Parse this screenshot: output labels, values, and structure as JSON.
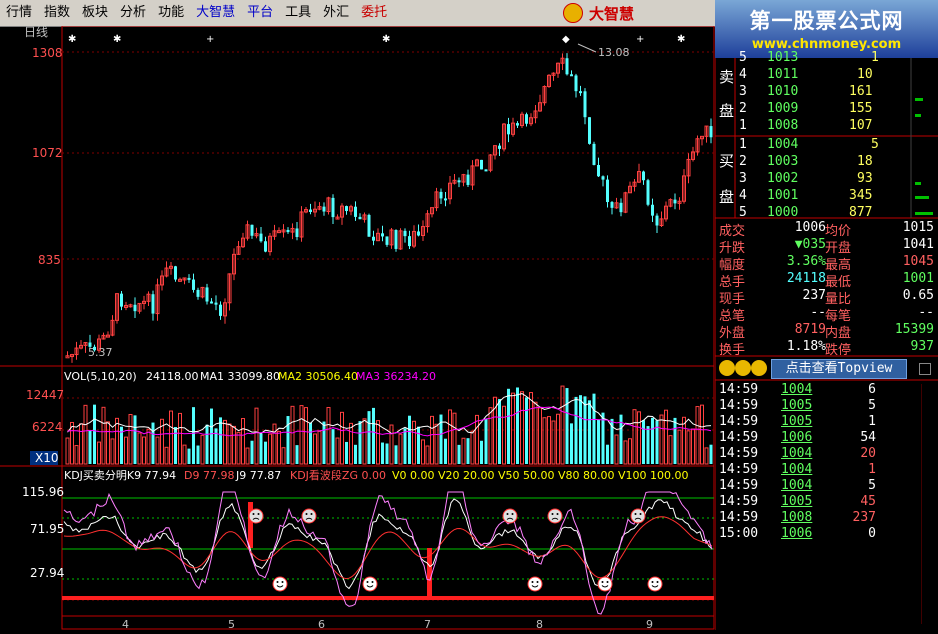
{
  "menu": [
    "行情",
    "指数",
    "板块",
    "分析",
    "功能",
    "大智慧",
    "平台",
    "工具",
    "外汇",
    "委托"
  ],
  "brand": "大智慧",
  "banner": {
    "title": "第一股票公式网",
    "url": "www.chnmoney.com"
  },
  "chart": {
    "period_label": "日线",
    "price_labels": [
      "1308",
      "1072",
      "835"
    ],
    "high_label": "13.08",
    "low_label": "5.37",
    "vol_labels": [
      "12447",
      "6224",
      "X10"
    ],
    "vol_legend": {
      "title": "VOL(5,10,20)",
      "v": "24118.00",
      "ma1": "MA1 33099.80",
      "ma2": "MA2 30506.40",
      "ma3": "MA3 36234.20"
    },
    "kdj_labels": [
      "115.96",
      "71.95",
      "27.94"
    ],
    "kdj_legend": {
      "title": "KDJ买卖分明K9 77.94",
      "d": "D9 77.98",
      "j": "J9 77.87",
      "zg": "KDJ看波段ZG 0.00",
      "rest": "V0 0.00 V20 20.00 V50 50.00 V80 80.00 V100 100.00"
    },
    "x_ticks": [
      "4",
      "5",
      "6",
      "7",
      "8",
      "9"
    ],
    "colors": {
      "up": "#ff4040",
      "down": "#54ffff",
      "ma1": "#ffffff",
      "ma2": "#ffff00",
      "ma3": "#ff00ff",
      "axis": "#c00000"
    }
  },
  "orderbook": {
    "sell_label": [
      "卖",
      "盘"
    ],
    "buy_label": [
      "买",
      "盘"
    ],
    "sell": [
      {
        "lvl": "5",
        "price": "1013",
        "vol": "1"
      },
      {
        "lvl": "4",
        "price": "1011",
        "vol": "10"
      },
      {
        "lvl": "3",
        "price": "1010",
        "vol": "161"
      },
      {
        "lvl": "2",
        "price": "1009",
        "vol": "155"
      },
      {
        "lvl": "1",
        "price": "1008",
        "vol": "107"
      }
    ],
    "buy": [
      {
        "lvl": "1",
        "price": "1004",
        "vol": "5"
      },
      {
        "lvl": "2",
        "price": "1003",
        "vol": "18"
      },
      {
        "lvl": "3",
        "price": "1002",
        "vol": "93"
      },
      {
        "lvl": "4",
        "price": "1001",
        "vol": "345"
      },
      {
        "lvl": "5",
        "price": "1000",
        "vol": "877"
      }
    ]
  },
  "stats": [
    {
      "l1": "成交",
      "v1": "1006",
      "l2": "均价",
      "v2": "1015"
    },
    {
      "l1": "升跌",
      "v1": "▼035",
      "l2": "开盘",
      "v2": "1041"
    },
    {
      "l1": "幅度",
      "v1": "3.36%",
      "l2": "最高",
      "v2": "1045"
    },
    {
      "l1": "总手",
      "v1": "24118",
      "l2": "最低",
      "v2": "1001"
    },
    {
      "l1": "现手",
      "v1": "237",
      "l2": "量比",
      "v2": "0.65"
    },
    {
      "l1": "总笔",
      "v1": "--",
      "l2": "每笔",
      "v2": "--"
    },
    {
      "l1": "外盘",
      "v1": "8719",
      "l2": "内盘",
      "v2": "15399"
    },
    {
      "l1": "换手",
      "v1": "1.18%",
      "l2": "跌停",
      "v2": "937"
    }
  ],
  "topview_label": "点击查看Topview",
  "ticks": [
    {
      "t": "14:59",
      "p": "1004",
      "v": "6"
    },
    {
      "t": "14:59",
      "p": "1005",
      "v": "5"
    },
    {
      "t": "14:59",
      "p": "1005",
      "v": "1"
    },
    {
      "t": "14:59",
      "p": "1006",
      "v": "54"
    },
    {
      "t": "14:59",
      "p": "1004",
      "v": "20"
    },
    {
      "t": "14:59",
      "p": "1004",
      "v": "1"
    },
    {
      "t": "14:59",
      "p": "1004",
      "v": "5"
    },
    {
      "t": "14:59",
      "p": "1005",
      "v": "45"
    },
    {
      "t": "14:59",
      "p": "1008",
      "v": "237"
    },
    {
      "t": "15:00",
      "p": "1006",
      "v": "0"
    }
  ]
}
